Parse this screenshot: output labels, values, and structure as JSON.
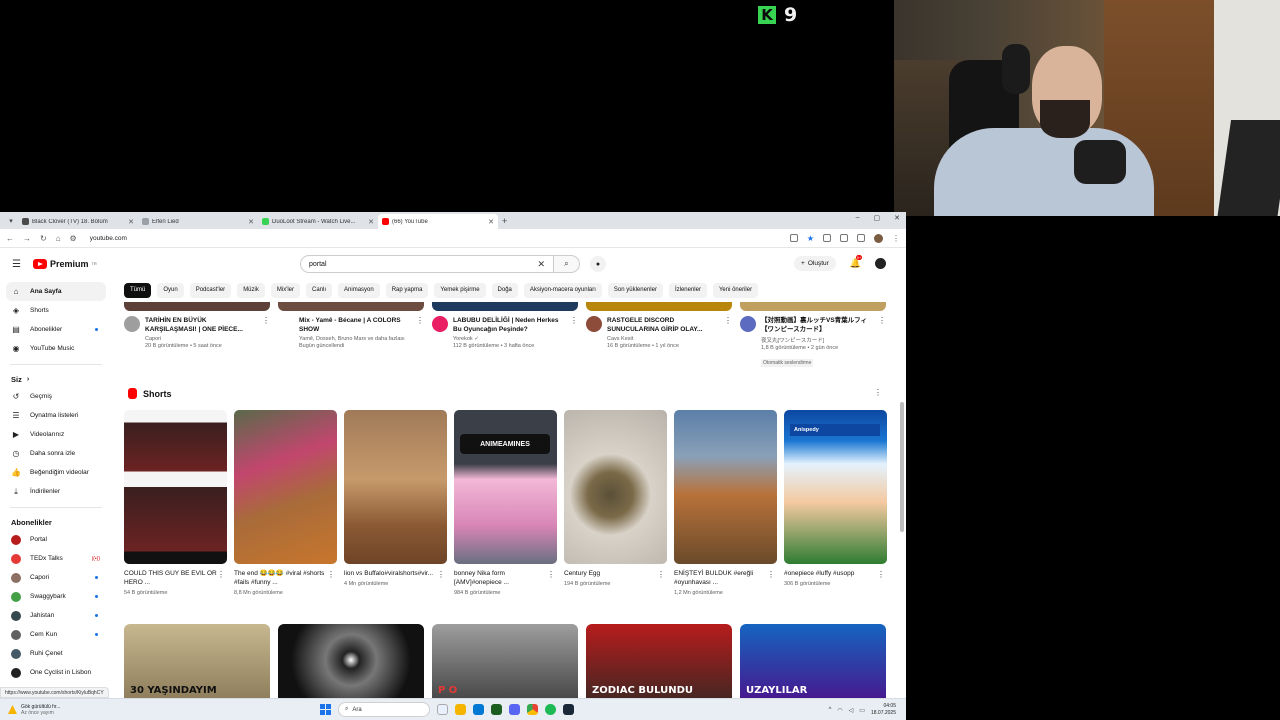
{
  "stream": {
    "counter": "9",
    "logo_letter": "K"
  },
  "tabs": [
    {
      "title": "Black Clover (TV) 18. Bölüm",
      "color": "#4a4a4a"
    },
    {
      "title": "Elfen Lied",
      "color": "#9aa0a6"
    },
    {
      "title": "DuoLoot Stream - Watch Live...",
      "color": "#39d353"
    },
    {
      "title": "(66) YouTube",
      "color": "#ff0000",
      "active": true
    }
  ],
  "address": {
    "url": "youtube.com"
  },
  "masthead": {
    "logo": "Premium",
    "logo_sup": "TR",
    "search_query": "portal",
    "create_label": "Oluştur",
    "bell_badge": "9+"
  },
  "sidebar": {
    "main_items": [
      {
        "label": "Ana Sayfa",
        "icon": "⌂",
        "active": true
      },
      {
        "label": "Shorts",
        "icon": "◈"
      },
      {
        "label": "Abonelikler",
        "icon": "▤",
        "dot": true
      },
      {
        "label": "YouTube Music",
        "icon": "◉"
      }
    ],
    "you_header": "Siz",
    "you_items": [
      {
        "label": "Geçmiş",
        "icon": "↺"
      },
      {
        "label": "Oynatma listeleri",
        "icon": "☰"
      },
      {
        "label": "Videolarınız",
        "icon": "▶"
      },
      {
        "label": "Daha sonra izle",
        "icon": "◷"
      },
      {
        "label": "Beğendiğim videolar",
        "icon": "👍"
      },
      {
        "label": "İndirilenler",
        "icon": "⤓"
      }
    ],
    "subs_header": "Abonelikler",
    "subs": [
      {
        "label": "Portal",
        "color": "#b71c1c"
      },
      {
        "label": "TEDx Talks",
        "color": "#e53935",
        "flag": true
      },
      {
        "label": "Capori",
        "color": "#8d6e63",
        "dot": true
      },
      {
        "label": "Swaggybark",
        "color": "#43a047",
        "dot": true
      },
      {
        "label": "Jahistan",
        "color": "#37474f",
        "dot": true
      },
      {
        "label": "Cem Kun",
        "color": "#616161",
        "dot": true
      },
      {
        "label": "Ruhi Çenet",
        "color": "#455a64"
      },
      {
        "label": "One Cyclist in Lisbon",
        "color": "#212121"
      }
    ]
  },
  "chips": [
    "Tümü",
    "Oyun",
    "Podcast'ler",
    "Müzik",
    "Mix'ler",
    "Canlı",
    "Animasyon",
    "Rap yapma",
    "Yemek pişirme",
    "Doğa",
    "Aksiyon-macera oyunları",
    "Son yüklenenler",
    "İzlenenler",
    "Yeni öneriler"
  ],
  "videos": [
    {
      "title": "TARİHİN EN BÜYÜK KARŞILAŞMASI! | ONE PİECE...",
      "channel": "Capori",
      "stats": "20 B görüntüleme • 5 saat önce",
      "color": "#5d4037",
      "avatar": "#9e9e9e"
    },
    {
      "title": "Mix - Yamê - Bécane | A COLORS SHOW",
      "channel": "Yamê, Dosseh, Bruno Mars ve daha fazlası",
      "stats": "Bugün güncellendi",
      "color": "#6d4c41",
      "avatar": ""
    },
    {
      "title": "LABUBU DELİLİĞİ | Neden Herkes Bu Oyuncağın Peşinde?",
      "channel": "Yorekok ✓",
      "stats": "112 B görüntüleme • 3 hafta önce",
      "color": "#1e3a5f",
      "avatar": "#e91e63"
    },
    {
      "title": "RASTGELE DISCORD SUNUCULARINA GİRİP OLAY...",
      "channel": "Cavs Kesit",
      "stats": "16 B görüntüleme • 1 yıl önce",
      "color": "#b8860b",
      "avatar": "#8d4b3a"
    },
    {
      "title": "【対照動画】裏ルッチVS青葉ルフィ【ワンピースカード】",
      "channel": "夜叉丸[ワンピースカード]",
      "stats": "1,8 B görüntüleme • 2 gün önce",
      "badge": "Otomatik seslendirme",
      "color": "#c0a060",
      "avatar": "#5c6bc0"
    }
  ],
  "shorts_title": "Shorts",
  "shorts": [
    {
      "title": "COULD THIS GUY BE EVIL OR HERO ...",
      "stats": "54 B görüntüleme",
      "bg": "linear-gradient(180deg,#f5f5f5 0%,#f5f5f5 8%,#3a1f1f 8%,#6d2323 40%,#f5f5f5 40%,#f5f5f5 50%,#3a1f1f 50%,#6d2323 92%,#111 92%)"
    },
    {
      "title": "The end 😂😂😂 #viral #shorts #fails #funny ...",
      "stats": "8,8 Mn görüntüleme",
      "bg": "linear-gradient(160deg,#5a6a4a 0%,#c2466e 35%,#a86b3a 60%,#c8762c 100%)"
    },
    {
      "title": "lion vs Buffalo#viralshorts#vir...",
      "stats": "4 Mn görüntüleme",
      "bg": "linear-gradient(180deg,#a07a58 0%,#c79a6c 45%,#8b5a34 75%,#6e4428 100%)"
    },
    {
      "title": "bonney Nika form [AMV]#onepiece ...",
      "stats": "984 B görüntüleme",
      "bg": "linear-gradient(180deg,#3a3f48 0%,#3a3f48 35%,#f2b8d6 45%,#d886b6 75%,#6a6f80 100%)",
      "label": "ANIMEAMINES"
    },
    {
      "title": "Century Egg",
      "stats": "194 B görüntüleme",
      "bg": "radial-gradient(circle at 45% 55%,#5a5038 0%,#7a6a48 22%,#d9d2c8 40%,#b8b2aa 100%)"
    },
    {
      "title": "ENİŞTEYİ BULDUK #ereğli #oyunhavası ...",
      "stats": "1,2 Mn görüntüleme",
      "bg": "linear-gradient(180deg,#5b7fa8 0%,#8aa0b8 30%,#b8723a 55%,#6a4a2a 100%)"
    },
    {
      "title": "#onepiece #luffy #usopp",
      "stats": "306 B görüntüleme",
      "bg": "linear-gradient(180deg,#0d47a1 0%,#1976d2 20%,#e3f2fd 35%,#f4c9a0 60%,#2e7d32 100%)",
      "label": "Anispedy"
    }
  ],
  "row3": [
    {
      "label": "30 YAŞINDAYIM",
      "bg": "linear-gradient(180deg,#c8b890,#8a7a58)",
      "fg": "#111"
    },
    {
      "label": "",
      "bg": "radial-gradient(circle at 50% 45%,#fff 0%,#222 10%,#777 30%,#111 70%)",
      "fg": "#fff"
    },
    {
      "label": "P O",
      "bg": "linear-gradient(180deg,#9e9e9e,#424242)",
      "fg": "#e53935"
    },
    {
      "label": "ZODIAC BULUNDU",
      "bg": "linear-gradient(180deg,#b71c1c,#3e2723)",
      "fg": "#fff"
    },
    {
      "label": "UZAYLILAR",
      "bg": "linear-gradient(180deg,#1565c0,#4a148c)",
      "fg": "#fff"
    }
  ],
  "status_url": "https://www.youtube.com/shorts/KiyluBqhCY",
  "taskbar": {
    "weather_line1": "Gök gürültülü fır...",
    "weather_line2": "Az önce yayım",
    "search": "Ara",
    "time": "04:05",
    "date": "18.07.2025"
  }
}
